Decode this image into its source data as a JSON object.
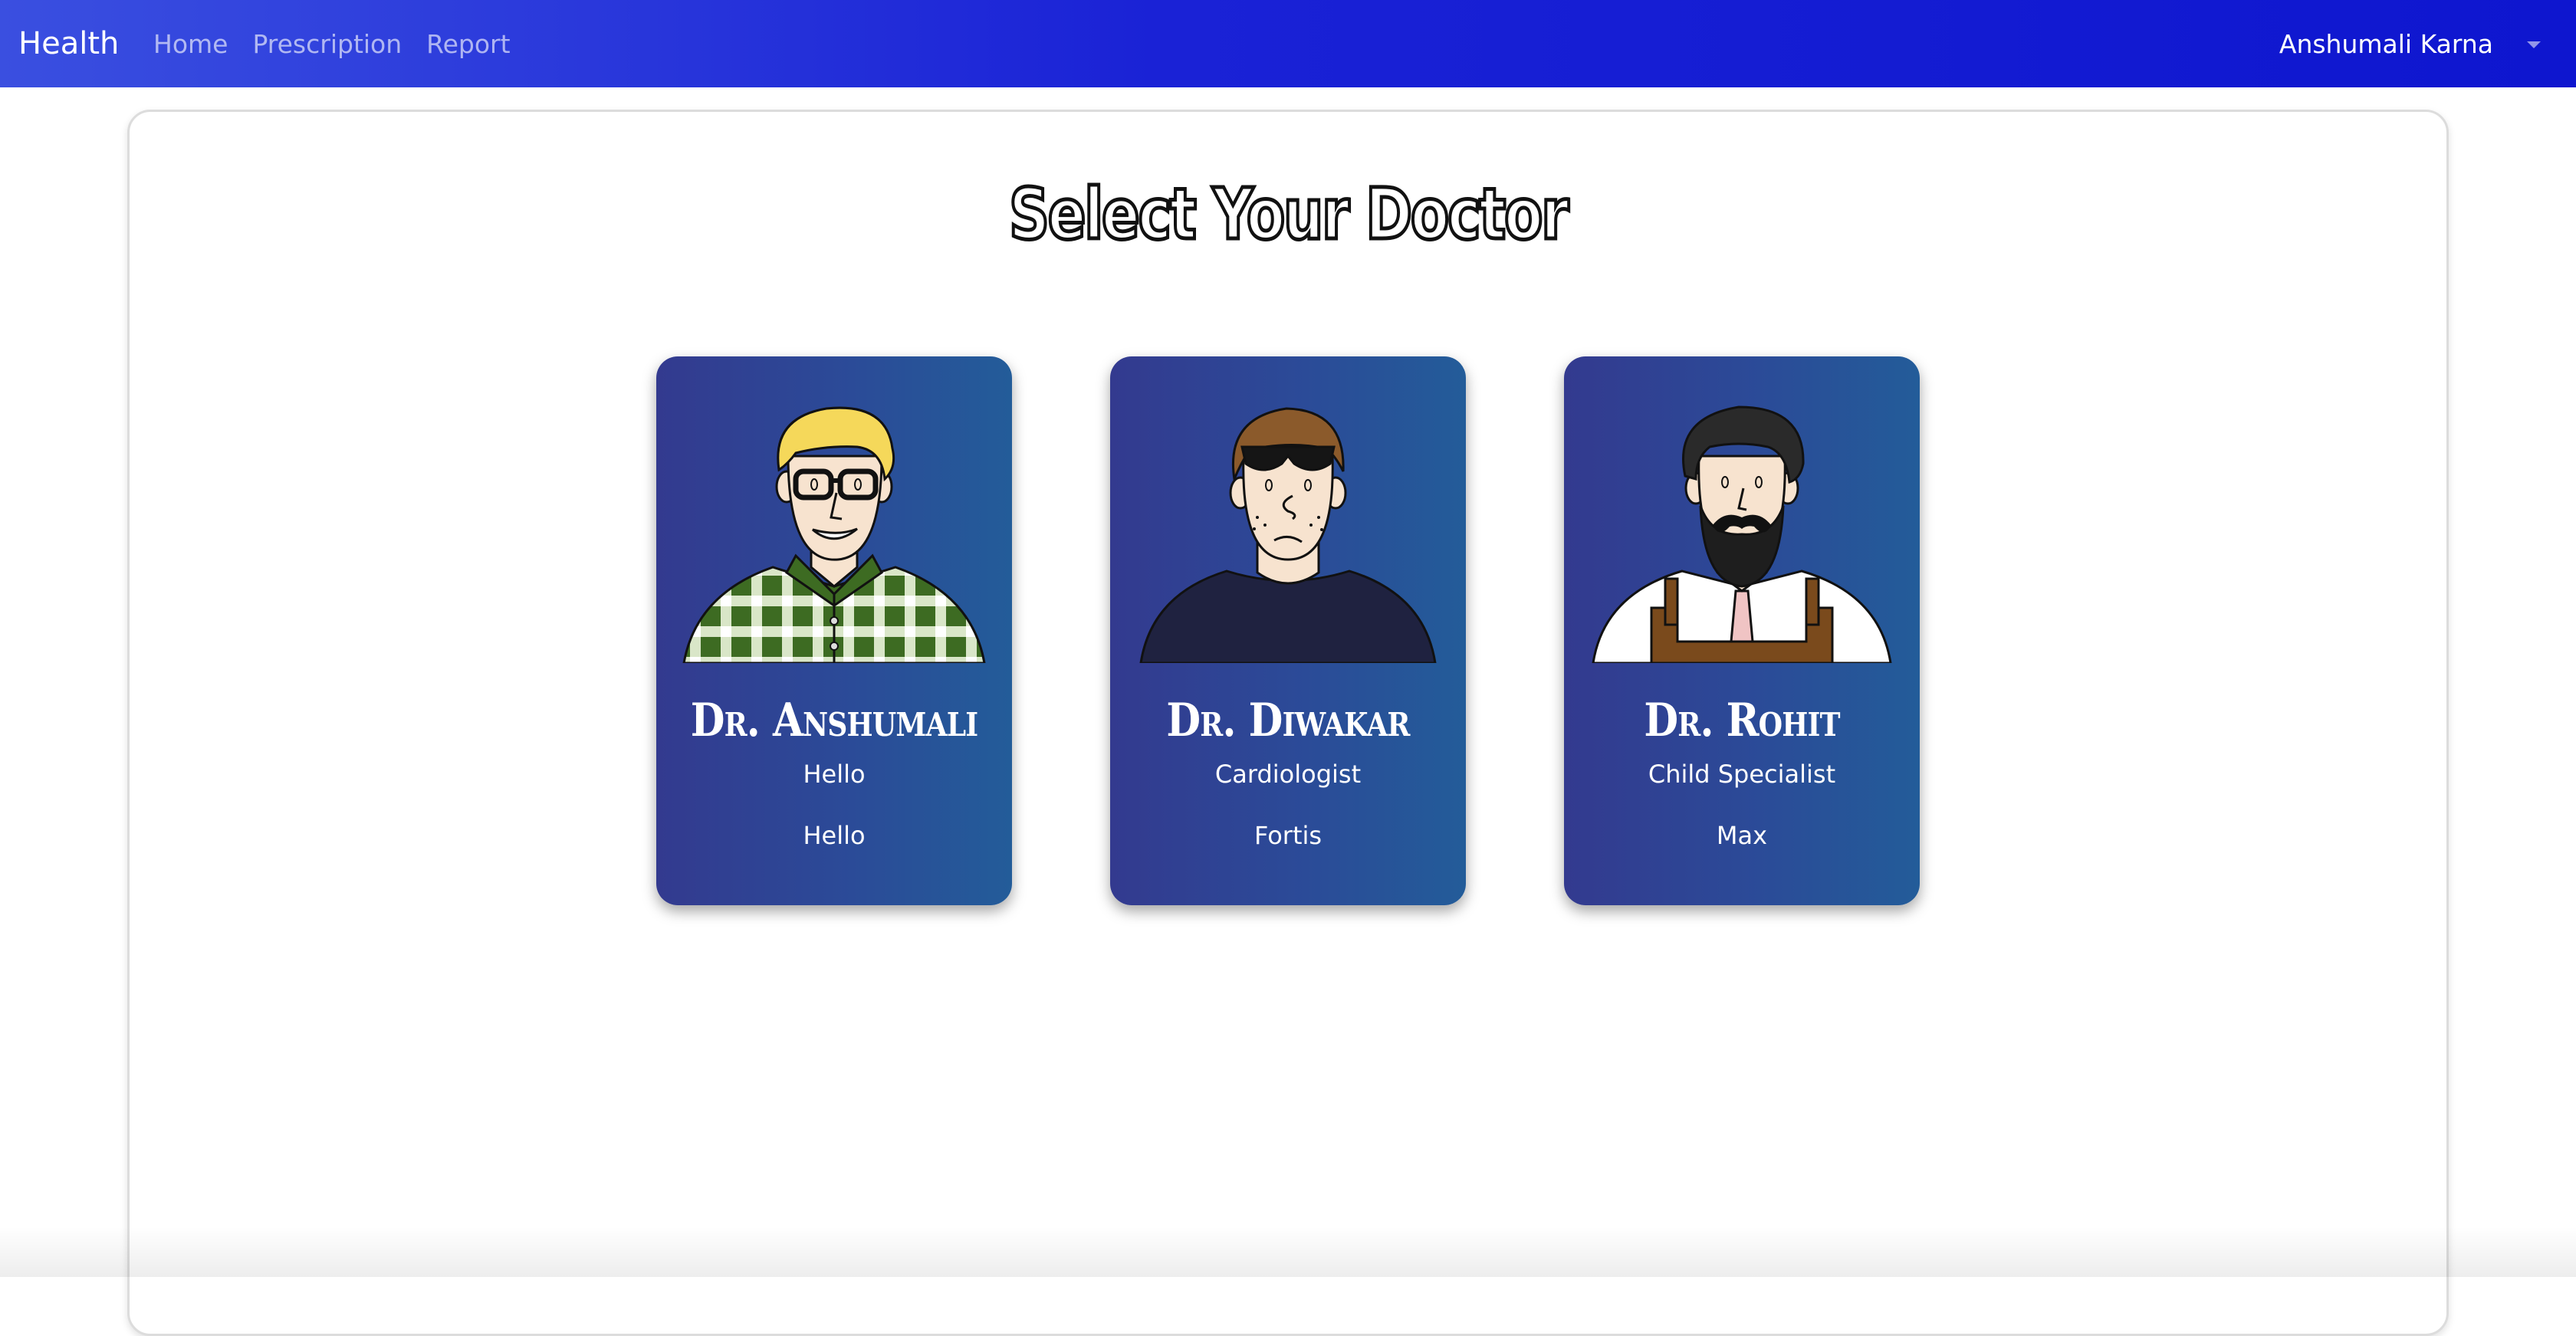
{
  "navbar": {
    "brand": "Health",
    "links": [
      "Home",
      "Prescription",
      "Report"
    ],
    "user": "Anshumali Karna"
  },
  "page": {
    "title": "Select Your Doctor"
  },
  "doctors": [
    {
      "name": "Dr. Anshumali",
      "specialty": "Hello",
      "hospital": "Hello",
      "avatar": "blond-glasses-plaid-avatar"
    },
    {
      "name": "Dr. Diwakar",
      "specialty": "Cardiologist",
      "hospital": "Fortis",
      "avatar": "sunglasses-tshirt-avatar"
    },
    {
      "name": "Dr. Rohit",
      "specialty": "Child Specialist",
      "hospital": "Max",
      "avatar": "bearded-apron-avatar"
    }
  ],
  "colors": {
    "navbar_start": "#3a4fe0",
    "navbar_end": "#0e16cf",
    "card_start": "#333a8f",
    "card_end": "#235c99"
  }
}
